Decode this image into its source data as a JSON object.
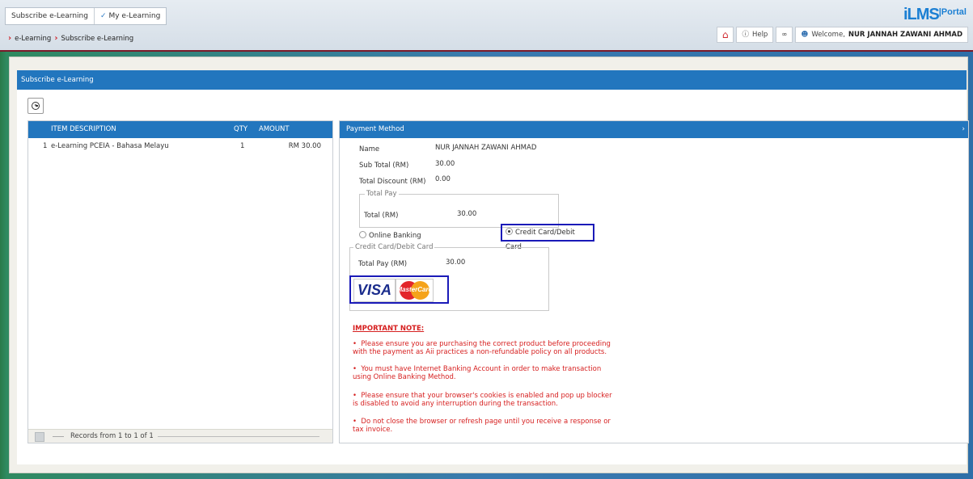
{
  "header": {
    "tabs": [
      {
        "label": "Subscribe e-Learning"
      },
      {
        "label": "My e-Learning",
        "icon": "chevron-down-icon"
      }
    ],
    "breadcrumb": [
      "e-Learning",
      "Subscribe e-Learning"
    ],
    "logo": {
      "main": "iLMS",
      "suffix": "|Portal"
    },
    "help_label": "Help",
    "welcome_prefix": "Welcome,",
    "user_name": "NUR JANNAH ZAWANI AHMAD"
  },
  "panel": {
    "title": "Subscribe e-Learning"
  },
  "items_table": {
    "columns": [
      "ITEM DESCRIPTION",
      "QTY",
      "AMOUNT"
    ],
    "rows": [
      {
        "no": "1",
        "description": "e-Learning PCEIA - Bahasa Melayu",
        "qty": "1",
        "amount": "RM 30.00"
      }
    ],
    "footer": "Records from 1 to 1 of 1"
  },
  "payment": {
    "title": "Payment Method",
    "name_label": "Name",
    "name_value": "NUR JANNAH ZAWANI AHMAD",
    "subtotal_label": "Sub Total (RM)",
    "subtotal_value": "30.00",
    "discount_label": "Total Discount (RM)",
    "discount_value": "0.00",
    "total_pay_legend": "Total Pay",
    "total_label": "Total (RM)",
    "total_value": "30.00",
    "option_online": "Online Banking",
    "option_card": "Credit Card/Debit Card",
    "selected_option": "Credit Card/Debit Card",
    "card_legend": "Credit Card/Debit Card",
    "card_total_label": "Total Pay (RM)",
    "card_total_value": "30.00",
    "card_logos": [
      "VISA",
      "MasterCard"
    ]
  },
  "notes": {
    "title": "IMPORTANT NOTE:",
    "items": [
      "Please ensure you are purchasing the correct product before proceeding with the payment as Aii practices a non-refundable policy on all products.",
      "You must have Internet Banking Account in order to make transaction using Online Banking Method.",
      "Please ensure that your browser's cookies is enabled and pop up blocker is disabled to avoid any interruption during the transaction.",
      "Do not close the browser or refresh page until you receive a response or tax invoice."
    ]
  },
  "colors": {
    "accent": "#2276be",
    "warning": "#d61f1f",
    "highlight": "#1a1ab8"
  }
}
